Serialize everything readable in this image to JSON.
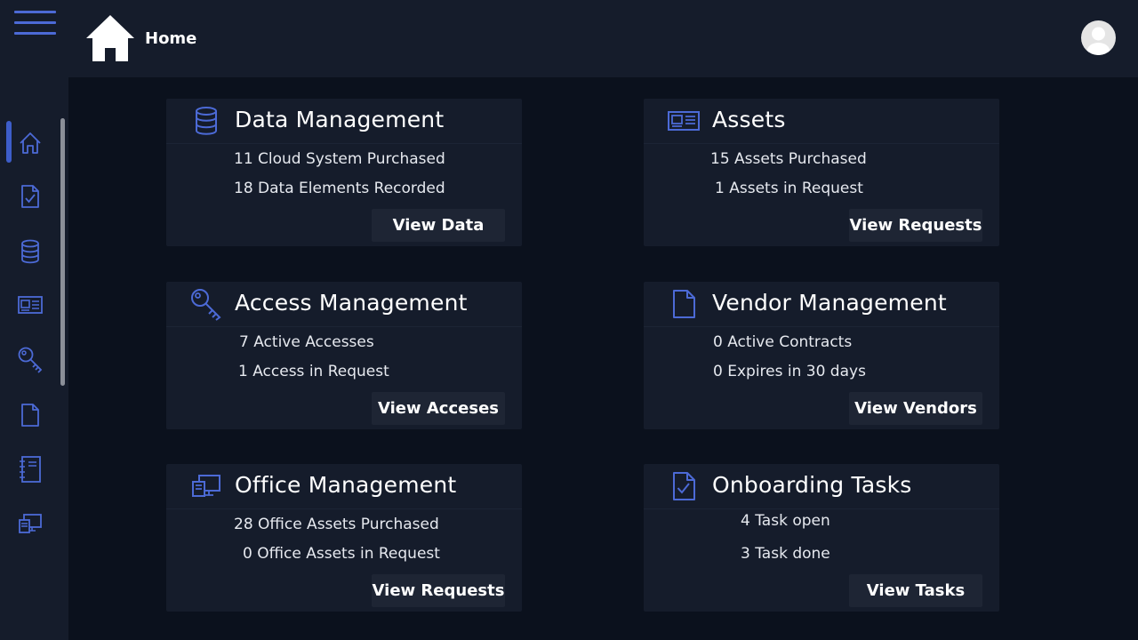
{
  "header": {
    "title": "Home",
    "menu_icon": "hamburger-menu-icon",
    "logo_icon": "home-icon",
    "avatar_icon": "user-avatar-icon"
  },
  "sidebar": {
    "items": [
      {
        "icon": "home-icon",
        "active": true
      },
      {
        "icon": "task-document-icon",
        "active": false
      },
      {
        "icon": "database-icon",
        "active": false
      },
      {
        "icon": "newspaper-icon",
        "active": false
      },
      {
        "icon": "key-icon",
        "active": false
      },
      {
        "icon": "document-icon",
        "active": false
      },
      {
        "icon": "notebook-icon",
        "active": false
      },
      {
        "icon": "computer-icon",
        "active": false
      }
    ]
  },
  "cards": [
    {
      "title": "Data Management",
      "icon": "database-icon",
      "stats": [
        "11 Cloud System Purchased",
        "18 Data Elements Recorded"
      ],
      "button": "View Data"
    },
    {
      "title": "Assets",
      "icon": "newspaper-icon",
      "stats": [
        "15 Assets Purchased",
        "1 Assets in Request"
      ],
      "button": "View Requests"
    },
    {
      "title": "Access Management",
      "icon": "key-icon",
      "stats": [
        "7 Active Accesses",
        "1 Access in Request"
      ],
      "button": "View Acceses"
    },
    {
      "title": "Vendor Management",
      "icon": "document-icon",
      "stats": [
        "0 Active Contracts",
        "0 Expires in 30 days"
      ],
      "button": "View Vendors"
    },
    {
      "title": "Office Management",
      "icon": "computer-icon",
      "stats": [
        "28 Office Assets Purchased",
        "0 Office Assets in Request"
      ],
      "button": "View Requests"
    },
    {
      "title": "Onboarding Tasks",
      "icon": "task-document-icon",
      "stats": [
        "4 Task open",
        "3 Task done"
      ],
      "button": "View Tasks"
    }
  ],
  "colors": {
    "background": "#0b111d",
    "panel": "#151c2b",
    "accent": "#4c6ad6",
    "button": "#1e2534",
    "text": "#ffffff"
  }
}
